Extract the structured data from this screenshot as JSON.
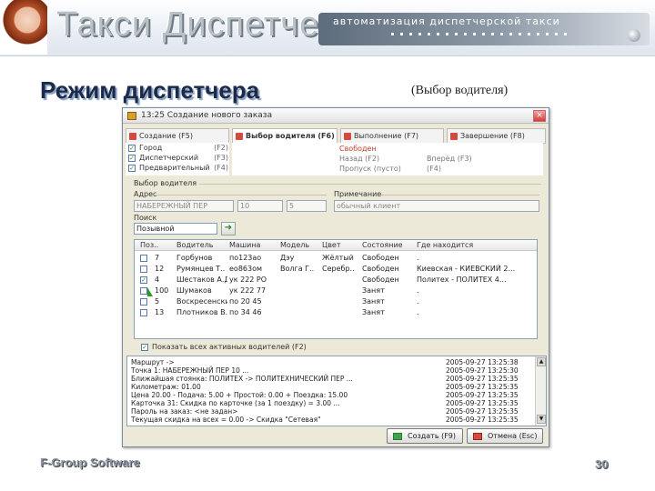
{
  "slide": {
    "brand": "Такси Диспетчер",
    "tagline": "автоматизация диспетчерской такси",
    "title": "Режим диспетчера",
    "subtitle": "(Выбор водителя)",
    "footer_left": "F-Group Software",
    "page_number": "30"
  },
  "window": {
    "title": "13:25 Создание нового заказа",
    "close": "×"
  },
  "tabs": [
    {
      "label": "Создание (F5)"
    },
    {
      "label": "Выбор водителя (F6)"
    },
    {
      "label": "Выполнение (F7)"
    },
    {
      "label": "Завершение (F8)"
    }
  ],
  "order_options": [
    {
      "label": "Город",
      "key": "(F2)",
      "checked": true
    },
    {
      "label": "Диспетчерский",
      "key": "(F3)",
      "checked": true
    },
    {
      "label": "Предварительный",
      "key": "(F4)",
      "checked": true
    }
  ],
  "driver_status": {
    "free": "Свободен",
    "lines": [
      {
        "label": "Назад (F2)",
        "key": "Вперёд (F3)"
      },
      {
        "label": "Пропуск (пусто)",
        "key": "(F4)"
      }
    ]
  },
  "driver_selection": {
    "section_label": "Выбор водителя",
    "address_label": "Адрес",
    "address_value": "НАБЕРЕЖНЫЙ ПЕР",
    "house_value": "10",
    "entrance_value": "5",
    "note_label": "Примечание",
    "note_value": "обычный клиент",
    "search_label": "Поиск",
    "search_value": "Позывной",
    "search_button": "➜"
  },
  "table": {
    "columns": [
      "Поз..",
      "Водитель",
      "Машина",
      "Модель",
      "Цвет",
      "Состояние",
      "Где находится"
    ],
    "rows": [
      {
        "checked": false,
        "cells": [
          "7",
          "Горбунов",
          "по123ао",
          "Дэу",
          "Жёлтый",
          "Свободен",
          "."
        ]
      },
      {
        "checked": false,
        "cells": [
          "12",
          "Румянцев Т..",
          "ео863ом",
          "Волга Г..",
          "Серебр..",
          "Свободен",
          "Киевская - КИЕВСКИЙ 2..."
        ]
      },
      {
        "checked": true,
        "cells": [
          "4",
          "Шестаков А.Д",
          "ук 222 РО",
          "",
          "",
          "Свободен",
          "Политех - ПОЛИТЕХ 4..."
        ]
      },
      {
        "checked": false,
        "cells": [
          "100",
          "Шумаков",
          "ук 222 77",
          "",
          "",
          "Занят",
          "."
        ]
      },
      {
        "checked": false,
        "cells": [
          "5",
          "Воскресенский А...",
          "по 20 45",
          "",
          "",
          "Занят",
          "."
        ]
      },
      {
        "checked": false,
        "cells": [
          "13",
          "Плотников В.И.",
          "по 34 46",
          "",
          "",
          "Занят",
          "."
        ]
      }
    ]
  },
  "show_all": {
    "label": "Показать всех активных водителей (F2)",
    "checked": true
  },
  "log": [
    {
      "msg": "Маршрут ->",
      "ts": "2005-09-27 13:25:38"
    },
    {
      "msg": "Точка 1: НАБЕРЕЖНЫЙ ПЕР 10 ...",
      "ts": "2005-09-27 13:25:30"
    },
    {
      "msg": "Ближайшая стоянка: ПОЛИТЕХ -> ПОЛИТЕХНИЧЕСКИЙ ПЕР ...",
      "ts": "2005-09-27 13:25:35"
    },
    {
      "msg": "Километраж: 01.00",
      "ts": "2005-09-27 13:25:35"
    },
    {
      "msg": "Цена 20.00 - Подача: 5.00 + Простой: 0.00 + Поездка: 15.00",
      "ts": "2005-09-27 13:25:35"
    },
    {
      "msg": "Карточка 31: Скидка по карточке (за 1 поездку) = 3.00 ...",
      "ts": "2005-09-27 13:25:35"
    },
    {
      "msg": "Пароль на заказ: <не задан>",
      "ts": "2005-09-27 13:25:35"
    },
    {
      "msg": "Текущая скидка на всех = 0.00 -> Скидка \"Сетевая\"",
      "ts": "2005-09-27 13:25:35"
    }
  ],
  "buttons": {
    "create": "Создать (F9)",
    "cancel": "Отмена (Esc)"
  },
  "colors": {
    "header_gradient": "#5d6c7c",
    "title": "#1c2a4a",
    "tab_icon": "#d24b3f",
    "status_free": "#b5402a"
  }
}
